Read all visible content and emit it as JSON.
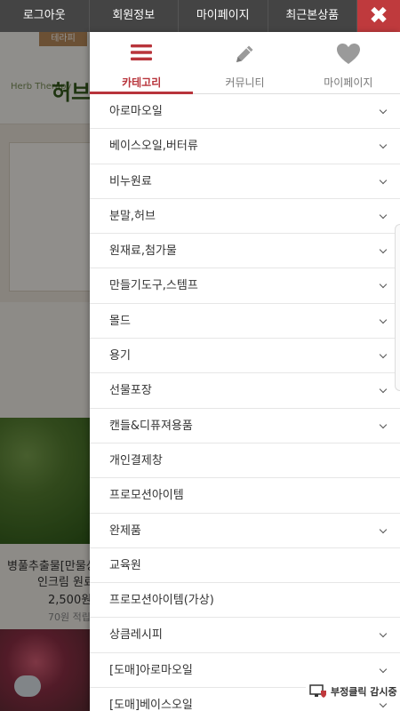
{
  "topbar": {
    "items": [
      "로그아웃",
      "회원정보",
      "마이페이지",
      "최근본상품"
    ],
    "close_glyph": "✖"
  },
  "drawer": {
    "tabs": [
      {
        "label": "카테고리",
        "icon": "hamburger-icon",
        "active": true
      },
      {
        "label": "커뮤니티",
        "icon": "pencil-icon",
        "active": false
      },
      {
        "label": "마이페이지",
        "icon": "heart-icon",
        "active": false
      }
    ],
    "menu": [
      {
        "label": "아로마오일",
        "has_arrow": true
      },
      {
        "label": "베이스오일,버터류",
        "has_arrow": true
      },
      {
        "label": "비누원료",
        "has_arrow": true
      },
      {
        "label": "분말,허브",
        "has_arrow": true
      },
      {
        "label": "원재료,첨가물",
        "has_arrow": true
      },
      {
        "label": "만들기도구,스템프",
        "has_arrow": true
      },
      {
        "label": "몰드",
        "has_arrow": true
      },
      {
        "label": "용기",
        "has_arrow": true
      },
      {
        "label": "선물포장",
        "has_arrow": true
      },
      {
        "label": "캔들&디퓨져용품",
        "has_arrow": true
      },
      {
        "label": "개인결제창",
        "has_arrow": false
      },
      {
        "label": "프로모션아이템",
        "has_arrow": false
      },
      {
        "label": "완제품",
        "has_arrow": true
      },
      {
        "label": "교육원",
        "has_arrow": false
      },
      {
        "label": "프로모션아이템(가상)",
        "has_arrow": false
      },
      {
        "label": "상큼레시피",
        "has_arrow": true
      },
      {
        "label": "[도매]아로마오일",
        "has_arrow": true
      },
      {
        "label": "[도매]베이스오일",
        "has_arrow": true
      }
    ],
    "accent_color": "#b8343b"
  },
  "background": {
    "logo_badge": "테라피",
    "brand_small": "Herb Therapy",
    "brand": "허브",
    "product_name_1": "병풀추출물[만물상",
    "product_name_2": "인크림 원료",
    "product_price": "2,500원",
    "product_points": "70원 적립"
  },
  "badge": {
    "text": "부정클릭 감시중"
  },
  "colors": {
    "topbar_bg": "#444444",
    "close_bg": "#bf3a3d"
  }
}
